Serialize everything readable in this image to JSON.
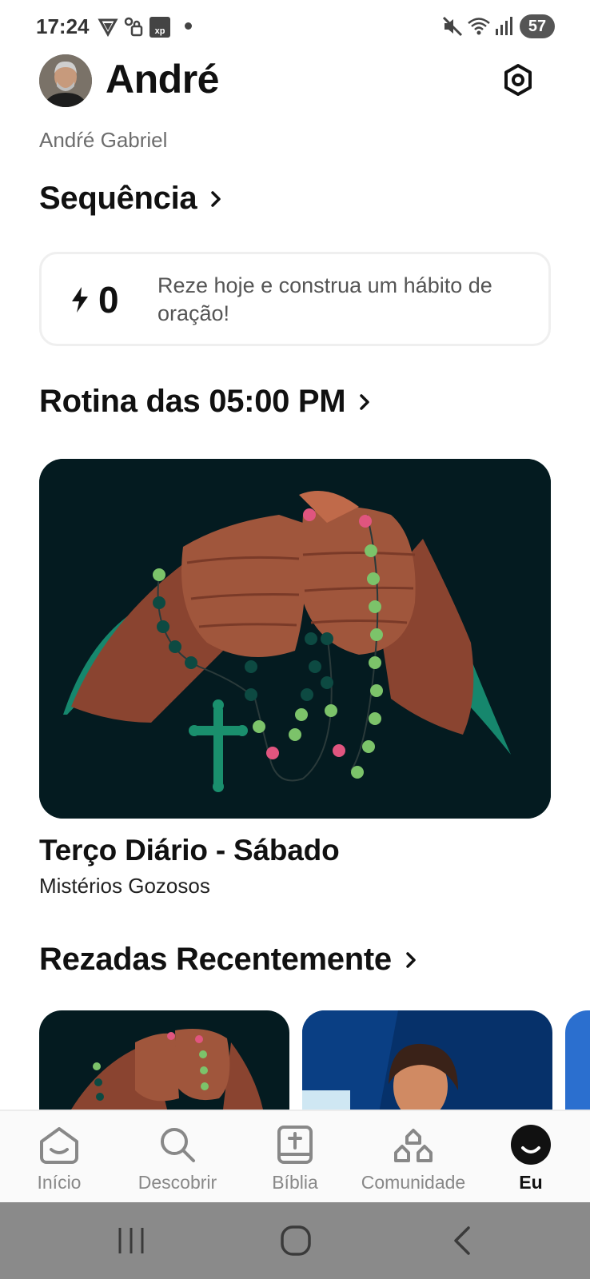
{
  "status_bar": {
    "time": "17:24",
    "battery": "57",
    "left_icons": [
      "vpn-icon",
      "voicemail-lock-icon",
      "xp-app-icon"
    ],
    "right_icons": [
      "mute-icon",
      "wifi-icon",
      "signal-icon"
    ]
  },
  "header": {
    "name": "André",
    "full_name": "Andŕé Gabriel",
    "settings_icon": "gear-icon"
  },
  "streak": {
    "heading": "Sequência",
    "count": "0",
    "message": "Reze hoje e construa um hábito de oração!"
  },
  "routine": {
    "heading": "Rotina das 05:00 PM",
    "title": "Terço Diário - Sábado",
    "subtitle": "Mistérios Gozosos"
  },
  "recent": {
    "heading": "Rezadas Recentemente"
  },
  "bottom_nav": {
    "items": [
      {
        "label": "Início",
        "icon": "home-icon"
      },
      {
        "label": "Descobrir",
        "icon": "search-icon"
      },
      {
        "label": "Bíblia",
        "icon": "bible-icon"
      },
      {
        "label": "Comunidade",
        "icon": "community-icon"
      },
      {
        "label": "Eu",
        "icon": "profile-icon"
      }
    ],
    "active": "Eu"
  },
  "system_nav": [
    "recents-icon",
    "home-icon",
    "back-icon"
  ],
  "colors": {
    "card_dark": "#041b20",
    "skin": "#a0563c",
    "rosary_green": "#7cc36a",
    "rosary_pink": "#e0557f",
    "teal": "#16876d"
  }
}
